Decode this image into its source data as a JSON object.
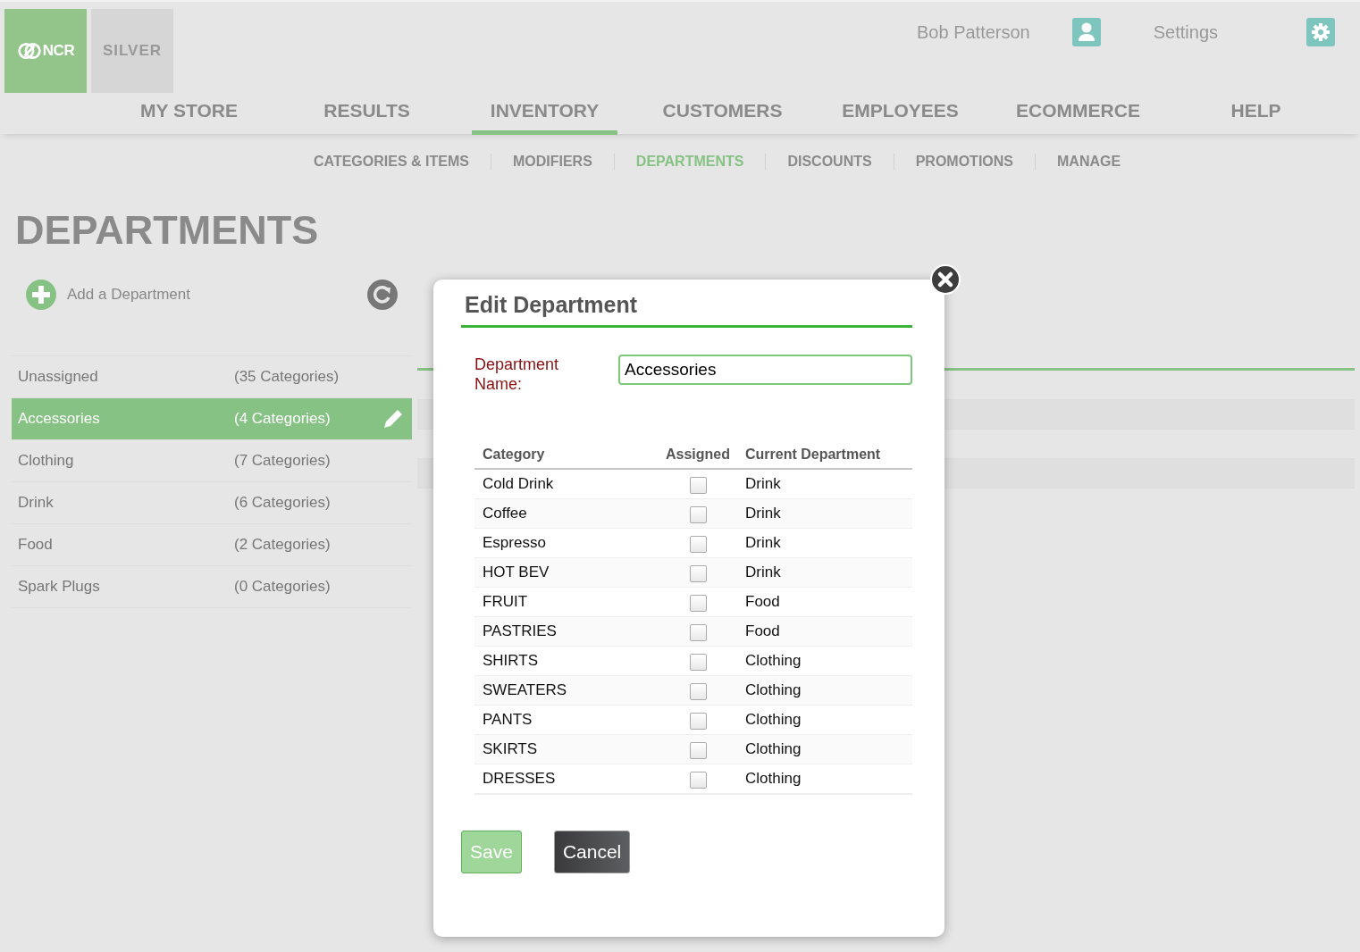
{
  "brand": {
    "company": "NCR",
    "product": "SILVER"
  },
  "user": {
    "name": "Bob Patterson",
    "settings": "Settings"
  },
  "nav": [
    {
      "label": "MY STORE",
      "selected": false
    },
    {
      "label": "RESULTS",
      "selected": false
    },
    {
      "label": "INVENTORY",
      "selected": true
    },
    {
      "label": "CUSTOMERS",
      "selected": false
    },
    {
      "label": "EMPLOYEES",
      "selected": false
    },
    {
      "label": "ECOMMERCE",
      "selected": false
    },
    {
      "label": "HELP",
      "selected": false
    }
  ],
  "subnav": [
    {
      "label": "CATEGORIES & ITEMS",
      "selected": false
    },
    {
      "label": "MODIFIERS",
      "selected": false
    },
    {
      "label": "DEPARTMENTS",
      "selected": true
    },
    {
      "label": "DISCOUNTS",
      "selected": false
    },
    {
      "label": "PROMOTIONS",
      "selected": false
    },
    {
      "label": "MANAGE",
      "selected": false
    }
  ],
  "page_title": "DEPARTMENTS",
  "add_department": "Add a Department",
  "departments": [
    {
      "name": "Unassigned",
      "count": "(35 Categories)",
      "selected": false
    },
    {
      "name": "Accessories",
      "count": "(4 Categories)",
      "selected": true
    },
    {
      "name": "Clothing",
      "count": "(7 Categories)",
      "selected": false
    },
    {
      "name": "Drink",
      "count": "(6 Categories)",
      "selected": false
    },
    {
      "name": "Food",
      "count": "(2 Categories)",
      "selected": false
    },
    {
      "name": "Spark Plugs",
      "count": "(0 Categories)",
      "selected": false
    }
  ],
  "detail_panel": {
    "rows": [
      {
        "kind": "plain"
      },
      {
        "kind": "striped"
      },
      {
        "kind": "plain"
      },
      {
        "kind": "striped"
      }
    ]
  },
  "dialog": {
    "title": "Edit Department",
    "name_label": "Department Name:",
    "name_value": "Accessories",
    "columns": [
      "Category",
      "Assigned",
      "Current Department"
    ],
    "rows": [
      {
        "category": "Cold Drink",
        "checked": false,
        "department": "Drink"
      },
      {
        "category": "Coffee",
        "checked": false,
        "department": "Drink"
      },
      {
        "category": "Espresso",
        "checked": false,
        "department": "Drink"
      },
      {
        "category": "HOT BEV",
        "checked": false,
        "department": "Drink"
      },
      {
        "category": "FRUIT",
        "checked": false,
        "department": "Food"
      },
      {
        "category": "PASTRIES",
        "checked": false,
        "department": "Food"
      },
      {
        "category": "SHIRTS",
        "checked": false,
        "department": "Clothing"
      },
      {
        "category": "SWEATERS",
        "checked": false,
        "department": "Clothing"
      },
      {
        "category": "PANTS",
        "checked": false,
        "department": "Clothing"
      },
      {
        "category": "SKIRTS",
        "checked": false,
        "department": "Clothing"
      },
      {
        "category": "DRESSES",
        "checked": false,
        "department": "Clothing"
      }
    ],
    "buttons": [
      {
        "label": "Save",
        "kind": "primary",
        "disabled": true
      },
      {
        "label": "Cancel",
        "kind": "secondary",
        "disabled": false
      }
    ]
  }
}
